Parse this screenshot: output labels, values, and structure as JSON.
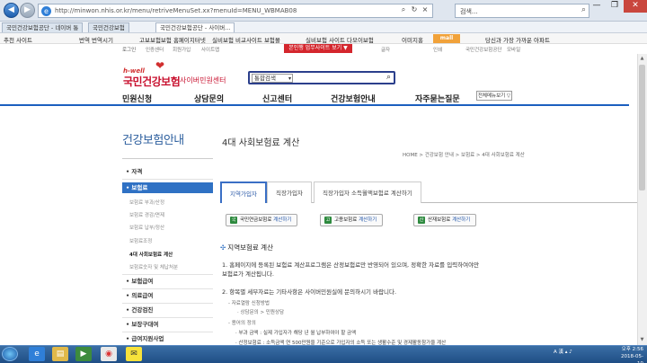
{
  "browser": {
    "url": "http://minwon.nhis.or.kr/menu/retriveMenuSet.xx?menuId=MENU_WBMAB08",
    "search_placeholder": "검색...",
    "tabs": [
      "국민건강보험공단 - 네이버 통",
      "국민건강보험",
      "국민건강보험공단 - 사이버..."
    ],
    "favorites": [
      "추천 사이트",
      "번역 번역시기",
      "고보보험보험 홈페이지터넷",
      "실비보험 비교사이트 보험몰",
      "실비보험 사이트 다모이보험"
    ],
    "toolbar_left": "의료보험관리공단 : 네이버 통합",
    "toolbar_right": [
      "이미지홍",
      "mall",
      "당신과 가장 가까운 아파트"
    ],
    "win_btns": [
      "—",
      "❐",
      "✕"
    ]
  },
  "site": {
    "red_button": "본인행 업무사이트 보기 ▼",
    "util_links": [
      "로그인",
      "인증센터",
      "회원가입",
      "사이트맵",
      "글자",
      "인쇄",
      "국민건강보험공단",
      "모바일"
    ],
    "logo_hwell": "h-well",
    "logo_main": "국민건강보험",
    "logo_sub": "사이버민원센터",
    "search_select": "통합검색",
    "nav": [
      "민원신청",
      "상담문의",
      "신고센터",
      "건강보험안내",
      "자주묻는질문"
    ],
    "all_menu": "전체메뉴보기 ▽"
  },
  "sidebar": {
    "title": "건강보험안내",
    "items": [
      {
        "label": "• 자격"
      },
      {
        "label": "• 보험료"
      },
      {
        "label": "• 보험급여"
      },
      {
        "label": "• 의료급여"
      },
      {
        "label": "• 건강검진"
      },
      {
        "label": "• 보장구대여"
      },
      {
        "label": "• 급여지원사업"
      }
    ],
    "subitems": [
      "보험료 부과/산정",
      "보험료 경감/면제",
      "보험료 납부/정산",
      "보험료조정",
      "4대 사회보험료 계산",
      "보험료숫자 및 체납처분"
    ]
  },
  "content": {
    "title": "4대 사회보험료 계산",
    "breadcrumb": "HOME > 건강보험 안내 > 보험료 > 4대 사회보험료 계산",
    "tabs": [
      "지역가입자",
      "직장가입자",
      "직장가입자 소득월액보험료 계산하기"
    ],
    "calc_buttons": [
      {
        "icon": "국",
        "label": "국민연금보험료",
        "action": "계산하기"
      },
      {
        "icon": "고",
        "label": "고용보험료",
        "action": "계산하기"
      },
      {
        "icon": "산",
        "label": "산재보험료",
        "action": "계산하기"
      }
    ],
    "section_title": "지역보험료 계산",
    "para1_line1": "1. 홈페이지에 등록된 보험료 계산프로그램은 산정보험료만 반영되어 있으며, 정확한 자료를 입력하여야만",
    "para1_line2": "보험료가 계산됩니다.",
    "para2": "2. 항목별 세부자료는 기타사항은 사이버민원실에 문의하시기 바랍니다.",
    "dash": [
      "- 자료열람 신청방법",
      "· 상담문의 > 민원상담",
      "- 용어의 정의",
      "· 부과 금액 : 실제 가입자가 해당 년 월 납부하여야 할 금액",
      "· 산정보험료 : 소득금액 연 500만원을 기준으로 가입자의 소득 또는 생활수준 및 경제활동참가율 계산"
    ]
  },
  "taskbar": {
    "tray": "A 漢 ▴ ♪",
    "time": "오후 2:56",
    "date": "2018-05-10"
  }
}
